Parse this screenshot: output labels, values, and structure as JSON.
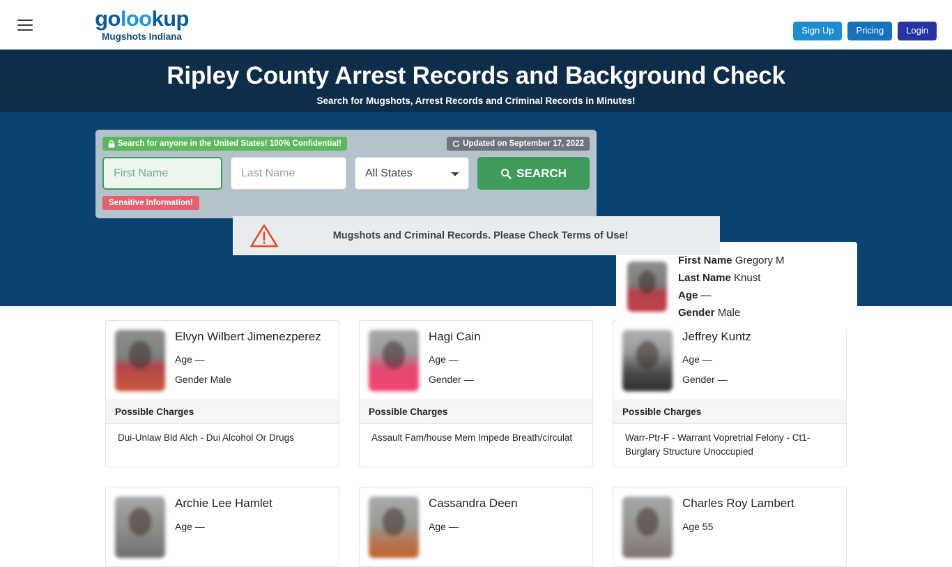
{
  "navbar": {
    "menu_icon": "hamburger-icon",
    "brand": {
      "logo_left": "go",
      "logo_mid": "loo",
      "logo_right": "kup",
      "subtitle": "Mugshots Indiana"
    },
    "buttons": {
      "signup": "Sign Up",
      "pricing": "Pricing",
      "login": "Login"
    },
    "colors": {
      "signup": "#1c8ed0",
      "pricing": "#1573bd",
      "login": "#2434a0"
    }
  },
  "hero": {
    "title": "Ripley County Arrest Records and Background Check",
    "subtitle": "Search for Mugshots, Arrest Records and Criminal Records in Minutes!",
    "background": "#0d2d4a"
  },
  "search": {
    "background": "#0b4370",
    "confidential_badge": "Search for anyone in the United States! 100% Confidential!",
    "confidential_icon": "lock-icon",
    "updated_badge": "Updated on September 17, 2022",
    "updated_icon": "refresh-icon",
    "sensitive_badge": "Sensitive Information!",
    "first_name_placeholder": "First Name",
    "first_name_value": "",
    "last_name_placeholder": "Last Name",
    "last_name_value": "",
    "state_selected": "All States",
    "state_options": [
      "All States"
    ],
    "search_button": "SEARCH",
    "search_icon": "search-icon",
    "accent_green": "#3f9c5d"
  },
  "featured": {
    "labels": {
      "first_name": "First Name",
      "last_name": "Last Name",
      "age": "Age",
      "gender": "Gender"
    },
    "first_name": "Gregory M",
    "last_name": "Knust",
    "age": "—",
    "gender": "Male",
    "thumb": "blurred-mugshot"
  },
  "warning": {
    "icon": "warning-triangle-icon",
    "text": "Mugshots and Criminal Records. Please Check Terms of Use!"
  },
  "results": {
    "charges_label": "Possible Charges",
    "age_label": "Age",
    "gender_label": "Gender",
    "cards": [
      {
        "name": "Elvyn Wilbert Jimenezperez",
        "age": "—",
        "gender": "Male",
        "charge": "Dui-Unlaw Bld Alch - Dui Alcohol Or Drugs",
        "thumb_class": "t-gray-red"
      },
      {
        "name": "Hagi Cain",
        "age": "—",
        "gender": "—",
        "charge": "Assault Fam/house Mem Impede Breath/circulat",
        "thumb_class": "t-gray-pink"
      },
      {
        "name": "Jeffrey Kuntz",
        "age": "—",
        "gender": "—",
        "charge": "Warr-Ptr-F - Warrant Vopretrial Felony - Ct1-Burglary Structure Unoccupied",
        "thumb_class": "t-gray-dark"
      },
      {
        "name": "Archie Lee Hamlet",
        "age": "—",
        "gender": "",
        "charge": "",
        "thumb_class": "t-gray-plain"
      },
      {
        "name": "Cassandra Deen",
        "age": "—",
        "gender": "",
        "charge": "",
        "thumb_class": "t-gray-orange"
      },
      {
        "name": "Charles Roy Lambert",
        "age": "55",
        "gender": "",
        "charge": "",
        "thumb_class": "t-gray-tan"
      }
    ]
  }
}
